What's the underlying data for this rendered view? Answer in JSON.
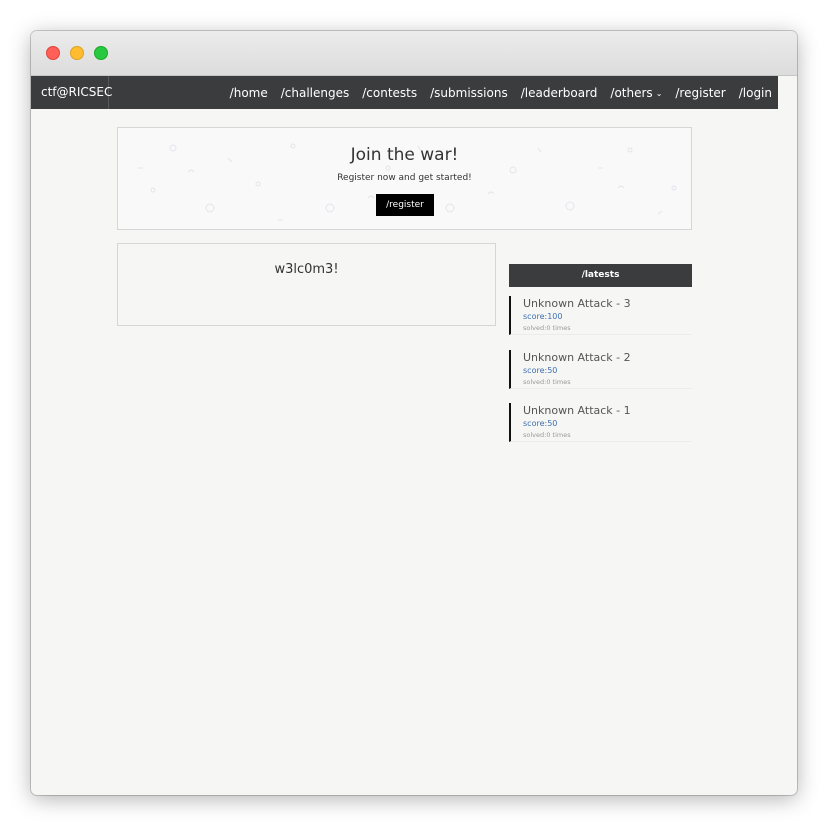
{
  "navbar": {
    "brand": "ctf@RICSEC",
    "links": [
      "/home",
      "/challenges",
      "/contests",
      "/submissions",
      "/leaderboard",
      "/others",
      "/register",
      "/login"
    ]
  },
  "banner": {
    "title": "Join the war!",
    "subtitle": "Register now and get started!",
    "button": "/register"
  },
  "welcome": {
    "text": "w3lc0m3!"
  },
  "latests": {
    "header": "/latests",
    "items": [
      {
        "title": "Unknown Attack - 3",
        "score": "score:100",
        "solved": "solved:0 times"
      },
      {
        "title": "Unknown Attack - 2",
        "score": "score:50",
        "solved": "solved:0 times"
      },
      {
        "title": "Unknown Attack - 1",
        "score": "score:50",
        "solved": "solved:0 times"
      }
    ]
  },
  "colors": {
    "navbar_bg": "#3b3c3e",
    "page_bg": "#f6f6f4",
    "score_blue": "#3d6fb0",
    "button_bg": "#000000"
  }
}
